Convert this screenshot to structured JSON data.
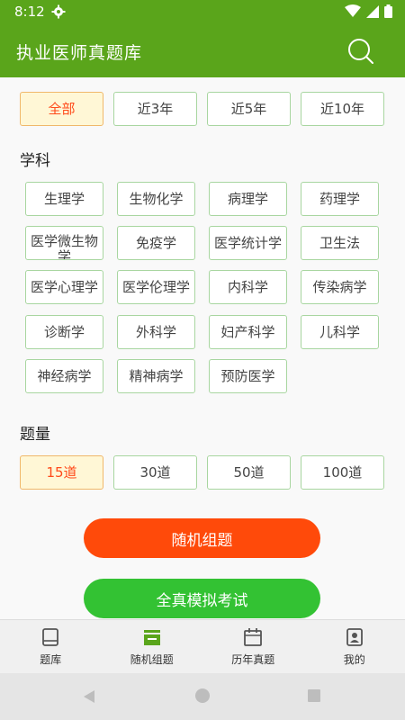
{
  "status": {
    "time": "8:12"
  },
  "app_bar": {
    "title": "执业医师真题库"
  },
  "filters": {
    "year_options": [
      "全部",
      "近3年",
      "近5年",
      "近10年"
    ],
    "subject_title": "学科",
    "subjects": [
      "生理学",
      "生物化学",
      "病理学",
      "药理学",
      "医学微生物学",
      "免疫学",
      "医学统计学",
      "卫生法",
      "医学心理学",
      "医学伦理学",
      "内科学",
      "传染病学",
      "诊断学",
      "外科学",
      "妇产科学",
      "儿科学",
      "神经病学",
      "精神病学",
      "预防医学"
    ],
    "count_title": "题量",
    "count_options": [
      "15道",
      "30道",
      "50道",
      "100道"
    ]
  },
  "actions": {
    "random_label": "随机组题",
    "mock_label": "全真模拟考试"
  },
  "tabs": [
    {
      "label": "题库",
      "icon": "book-icon"
    },
    {
      "label": "随机组题",
      "icon": "inbox-icon"
    },
    {
      "label": "历年真题",
      "icon": "calendar-icon"
    },
    {
      "label": "我的",
      "icon": "contact-book-icon"
    }
  ],
  "colors": {
    "primary_green": "#5aa51b",
    "selected_text": "#ff4a1a",
    "selected_bg": "#fff7d6",
    "random_button": "#ff4a0a",
    "mock_button": "#33c233"
  }
}
